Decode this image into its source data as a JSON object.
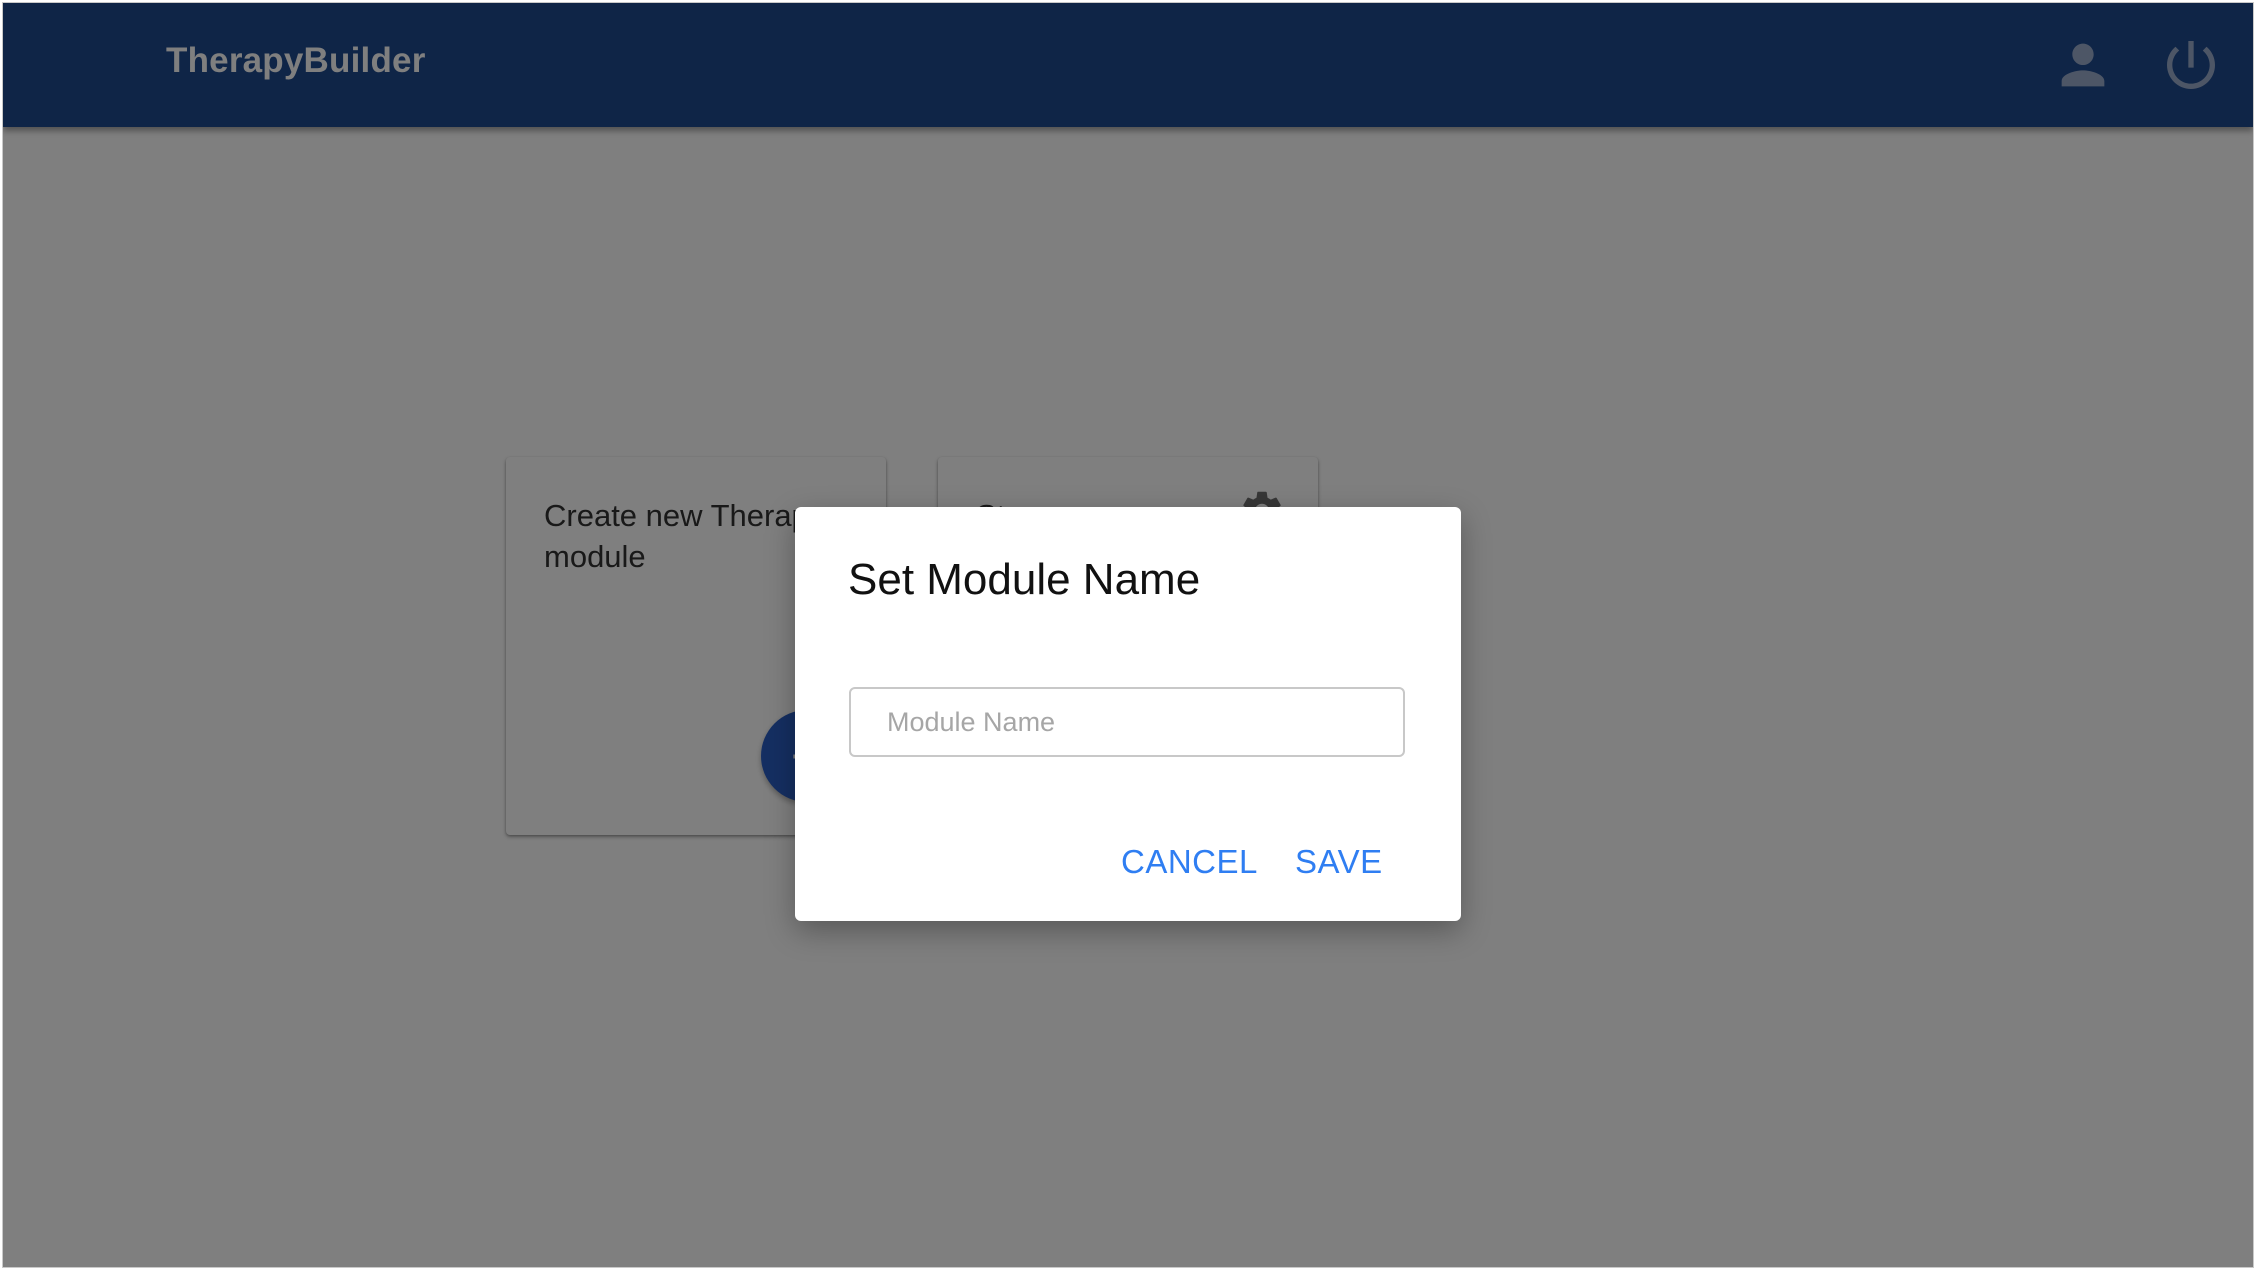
{
  "app": {
    "title": "TherapyBuilder",
    "header_color": "#1f4a8f",
    "icons": [
      "account-icon",
      "power-icon"
    ]
  },
  "modules": {
    "create_card": {
      "title": "Create new Therapy-module",
      "action_icon": "plus-icon"
    },
    "existing_card": {
      "title": "Stress",
      "settings_icon": "gear-icon"
    }
  },
  "dialog": {
    "title": "Set Module Name",
    "input_value": "",
    "input_placeholder": "Module Name",
    "cancel_label": "CANCEL",
    "save_label": "SAVE",
    "accent_color": "#2f7ef2"
  }
}
